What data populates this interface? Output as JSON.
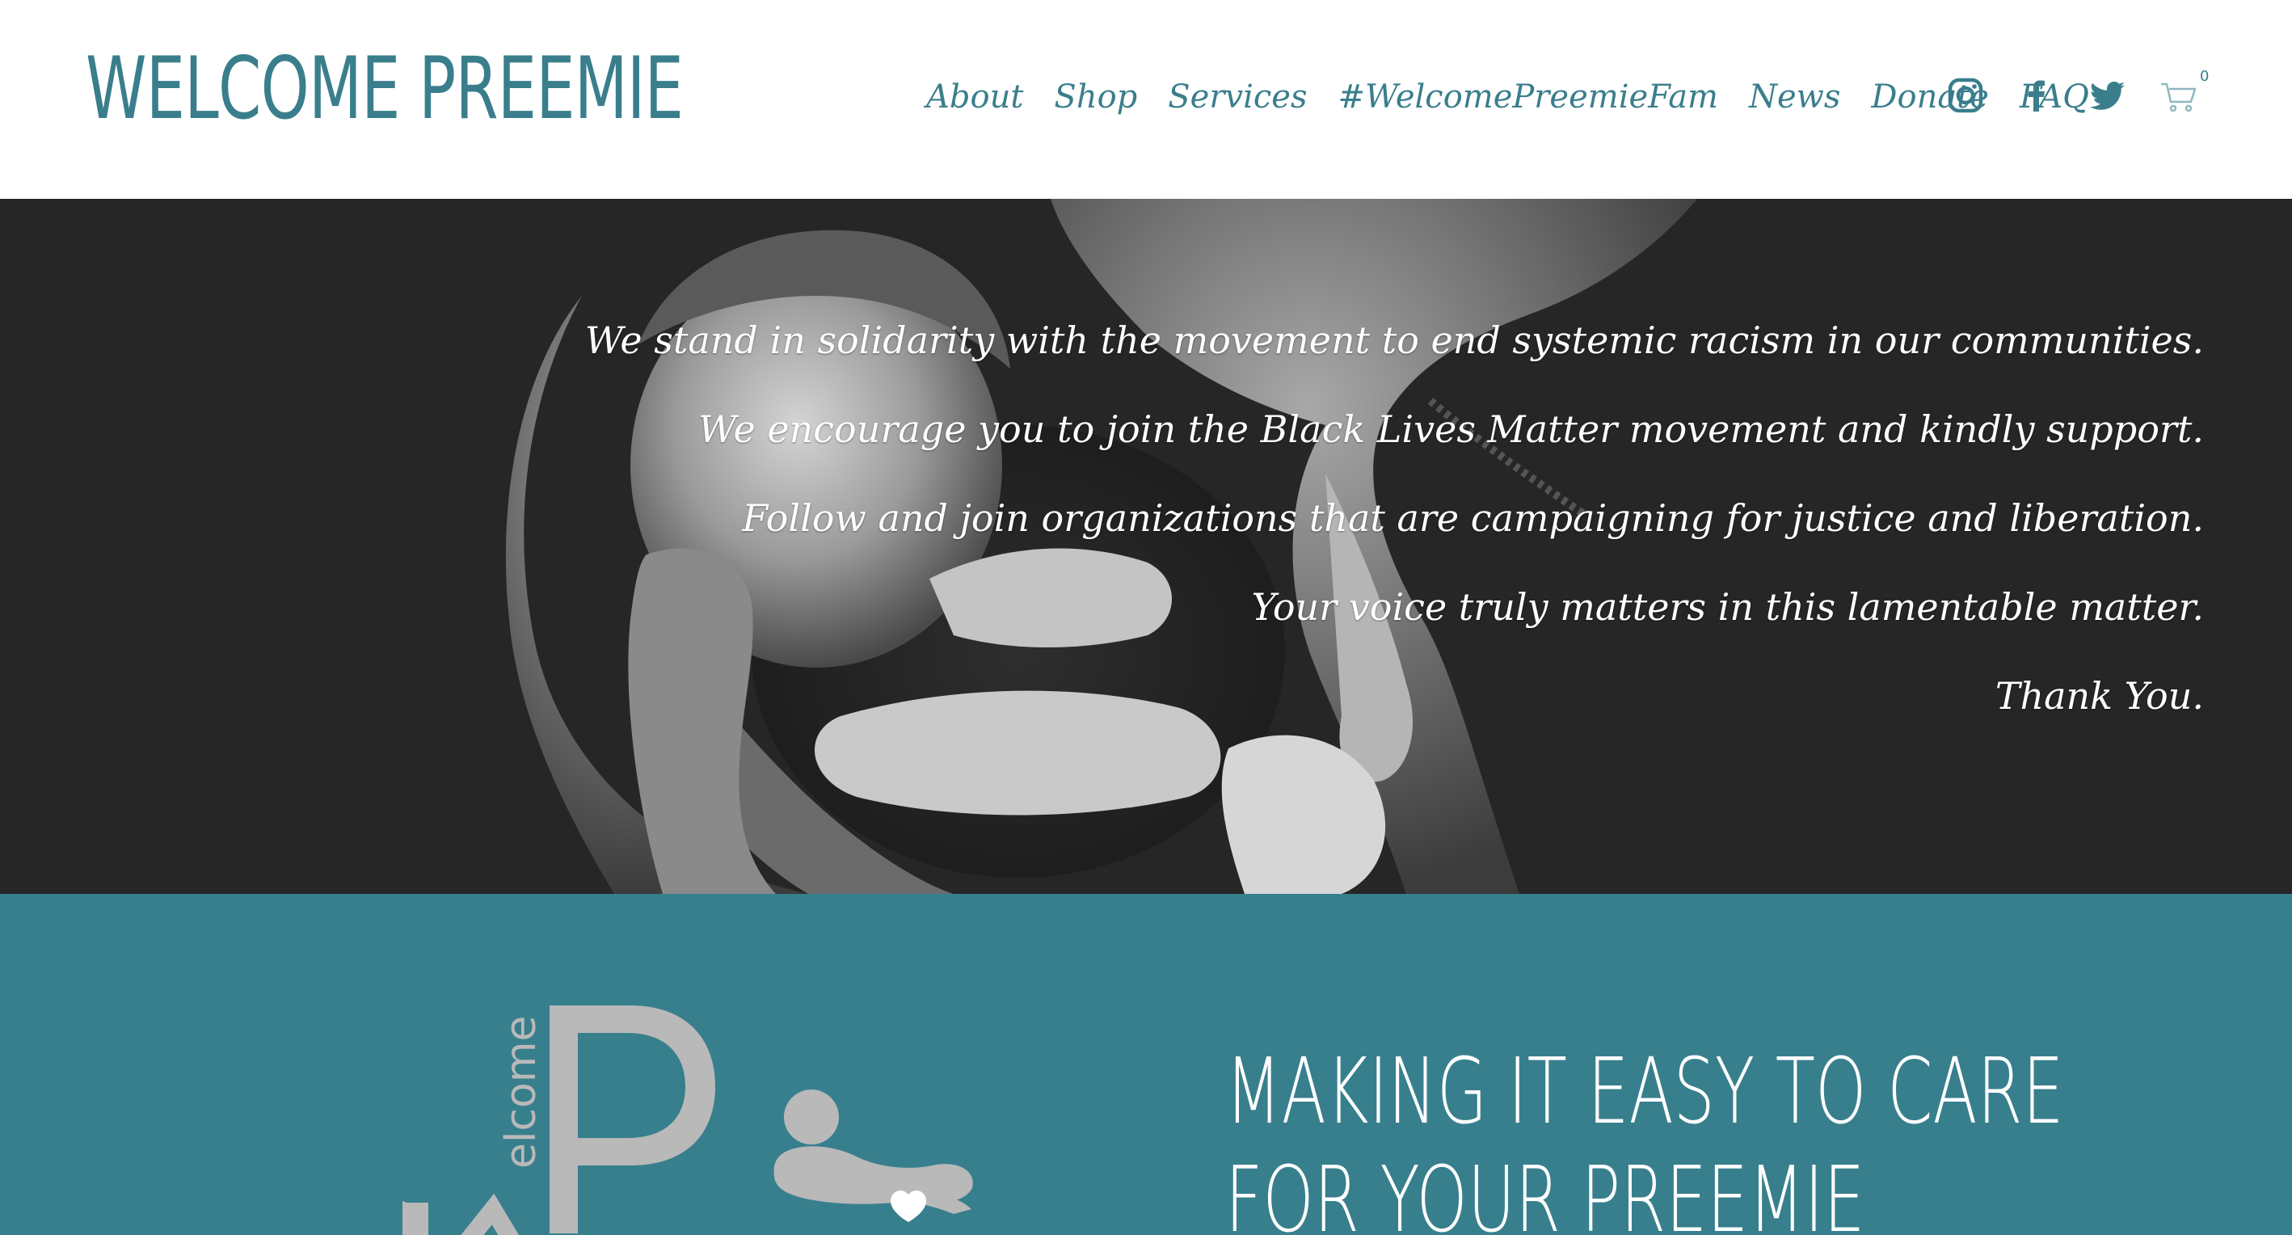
{
  "header": {
    "logo": "WELCOME PREEMIE",
    "nav": [
      "About",
      "Shop",
      "Services",
      "#WelcomePreemieFam",
      "News",
      "Donate",
      "FAQ"
    ],
    "icons": [
      "instagram-icon",
      "facebook-icon",
      "twitter-icon",
      "cart-icon"
    ],
    "cart_count": "0"
  },
  "hero": {
    "lines": [
      "We stand in solidarity with the movement to end systemic racism in our communities.",
      "We encourage you to join the Black Lives Matter movement and kindly support.",
      "Follow and join organizations that are campaigning for justice and liberation.",
      "Your voice truly matters in this lamentable matter.",
      "Thank You."
    ]
  },
  "section": {
    "logo_mark_text": "elcome",
    "tagline_line1": "MAKING IT EASY TO CARE",
    "tagline_line2": "FOR YOUR PREEMIE"
  },
  "colors": {
    "brand_teal": "#3a7e8c",
    "section_bg": "#387f8d",
    "hero_bg": "#262626",
    "logo_gray": "#b9b9b9"
  }
}
